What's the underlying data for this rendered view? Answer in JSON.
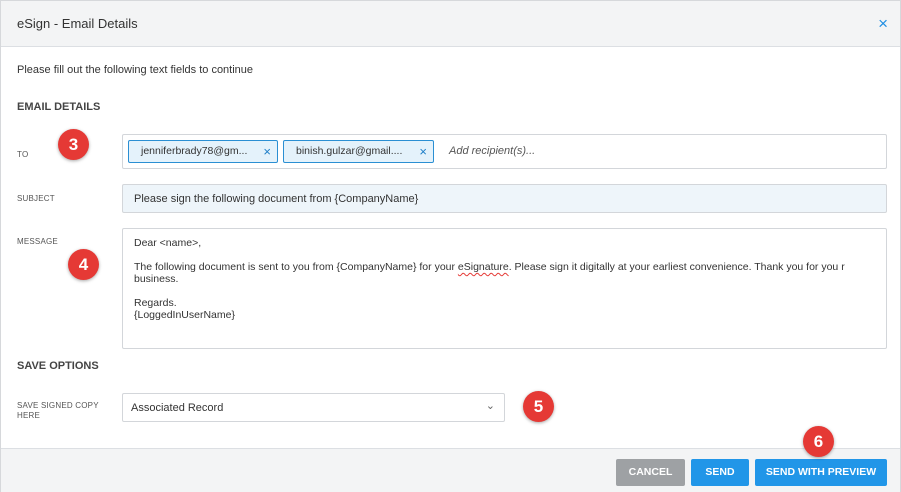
{
  "header": {
    "title": "eSign - Email Details",
    "close_icon": "×"
  },
  "instruction": "Please fill out the following text fields to continue",
  "sections": {
    "email_details": "EMAIL DETAILS",
    "save_options": "SAVE OPTIONS"
  },
  "to": {
    "label": "TO",
    "recipients": [
      "jenniferbrady78@gm...",
      "binish.gulzar@gmail...."
    ],
    "remove_icon": "×",
    "placeholder": "Add recipient(s)..."
  },
  "subject": {
    "label": "SUBJECT",
    "value": "Please sign the following document from {CompanyName}"
  },
  "message": {
    "label": "MESSAGE",
    "greeting": "Dear <name>,",
    "body_before": "The following document is sent to you from {CompanyName} for your ",
    "body_word": "eSignature",
    "body_after": ". Please sign it digitally at your earliest convenience. Thank you for you r business.",
    "regards": "Regards.",
    "signature": "{LoggedInUserName}"
  },
  "save_copy": {
    "label_line1": "SAVE SIGNED COPY",
    "label_line2": "HERE",
    "selected": "Associated Record",
    "chevron_icon": "⌄"
  },
  "footer": {
    "cancel": "CANCEL",
    "send": "SEND",
    "send_preview": "SEND WITH PREVIEW"
  },
  "markers": [
    "3",
    "4",
    "5",
    "6"
  ],
  "colors": {
    "accent": "#2196e8",
    "marker": "#e53935",
    "cancel": "#9ea1a4"
  }
}
